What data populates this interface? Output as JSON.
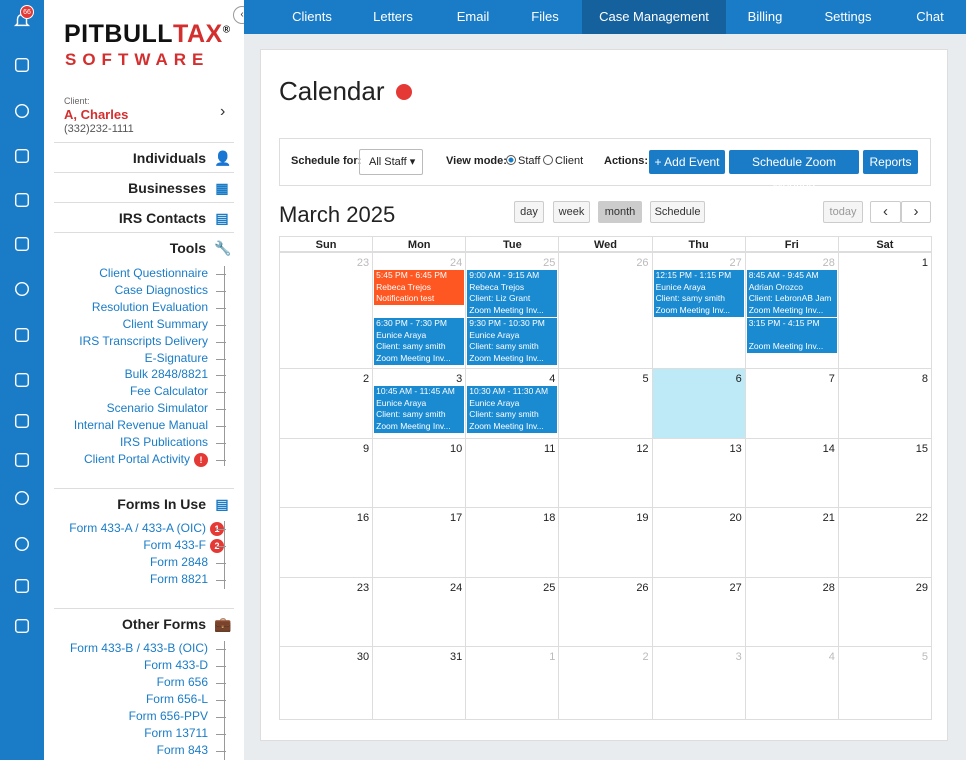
{
  "rail": {
    "bell_badge": "66",
    "icons": [
      "bell-icon",
      "printer-icon",
      "check-circle-icon",
      "add-user-icon",
      "pen-icon",
      "id-card-icon",
      "clock-icon",
      "document-icon",
      "invoice-icon",
      "briefcase-icon",
      "video-icon",
      "lifebuoy-icon",
      "help-icon",
      "robot-icon",
      "presentation-icon"
    ]
  },
  "logo": {
    "line1a": "PITBULL",
    "line1b": "TAX",
    "reg": "®",
    "line2": "SOFTWARE"
  },
  "client": {
    "label": "Client:",
    "name": "A, Charles",
    "phone": "(332)232-1111"
  },
  "sections": {
    "individuals": "Individuals",
    "businesses": "Businesses",
    "irs_contacts": "IRS Contacts",
    "tools": "Tools",
    "forms_in_use": "Forms In Use",
    "other_forms": "Other Forms"
  },
  "tools": [
    "Client Questionnaire",
    "Case Diagnostics",
    "Resolution Evaluation",
    "Client Summary",
    "IRS Transcripts Delivery",
    "E-Signature",
    "Bulk 2848/8821",
    "Fee Calculator",
    "Scenario Simulator",
    "Internal Revenue Manual",
    "IRS Publications",
    "Client Portal Activity"
  ],
  "tools_badge": "!",
  "forms_in_use": [
    {
      "label": "Form 433-A / 433-A (OIC)",
      "badge": "1"
    },
    {
      "label": "Form 433-F",
      "badge": "2"
    },
    {
      "label": "Form 2848",
      "badge": ""
    },
    {
      "label": "Form 8821",
      "badge": ""
    }
  ],
  "other_forms": [
    "Form 433-B / 433-B (OIC)",
    "Form 433-D",
    "Form 656",
    "Form 656-L",
    "Form 656-PPV",
    "Form 13711",
    "Form 843"
  ],
  "nav": {
    "collapse": "‹",
    "items": [
      "Clients",
      "Letters",
      "Email",
      "Files",
      "Case Management",
      "Billing",
      "Settings",
      "Chat"
    ],
    "active": "Case Management"
  },
  "page": {
    "title": "Calendar"
  },
  "toolbar": {
    "schedule_label": "Schedule for:",
    "schedule_value": "All Staff",
    "view_label": "View mode:",
    "view_staff": "Staff",
    "view_client": "Client",
    "actions_label": "Actions:",
    "add_event": "+ Add Event",
    "zoom": "Schedule Zoom Meeting",
    "reports": "Reports"
  },
  "calendar": {
    "month": "March 2025",
    "views": [
      "day",
      "week",
      "month",
      "Schedule"
    ],
    "active_view": "month",
    "today": "today",
    "prev": "‹",
    "next": "›",
    "weekdays": [
      "Sun",
      "Mon",
      "Tue",
      "Wed",
      "Thu",
      "Fri",
      "Sat"
    ],
    "weeks": [
      [
        {
          "d": "23",
          "dim": true
        },
        {
          "d": "24",
          "dim": true
        },
        {
          "d": "25",
          "dim": true
        },
        {
          "d": "26",
          "dim": true
        },
        {
          "d": "27",
          "dim": true
        },
        {
          "d": "28",
          "dim": true
        },
        {
          "d": "1"
        }
      ],
      [
        {
          "d": "2"
        },
        {
          "d": "3"
        },
        {
          "d": "4"
        },
        {
          "d": "5"
        },
        {
          "d": "6",
          "today": true
        },
        {
          "d": "7"
        },
        {
          "d": "8"
        }
      ],
      [
        {
          "d": "9"
        },
        {
          "d": "10"
        },
        {
          "d": "11"
        },
        {
          "d": "12"
        },
        {
          "d": "13"
        },
        {
          "d": "14"
        },
        {
          "d": "15"
        }
      ],
      [
        {
          "d": "16"
        },
        {
          "d": "17"
        },
        {
          "d": "18"
        },
        {
          "d": "19"
        },
        {
          "d": "20"
        },
        {
          "d": "21"
        },
        {
          "d": "22"
        }
      ],
      [
        {
          "d": "23"
        },
        {
          "d": "24"
        },
        {
          "d": "25"
        },
        {
          "d": "26"
        },
        {
          "d": "27"
        },
        {
          "d": "28"
        },
        {
          "d": "29"
        }
      ],
      [
        {
          "d": "30"
        },
        {
          "d": "31"
        },
        {
          "d": "1",
          "dim": true
        },
        {
          "d": "2",
          "dim": true
        },
        {
          "d": "3",
          "dim": true
        },
        {
          "d": "4",
          "dim": true
        },
        {
          "d": "5",
          "dim": true
        }
      ]
    ],
    "events": [
      {
        "week": 0,
        "day": 1,
        "slot": 0,
        "color": "red",
        "lines": [
          "5:45 PM - 6:45 PM",
          "Rebeca Trejos",
          "Notification test"
        ]
      },
      {
        "week": 0,
        "day": 1,
        "slot": 1,
        "lines": [
          "6:30 PM - 7:30 PM",
          "Eunice Araya",
          "Client: samy smith",
          "Zoom Meeting Inv..."
        ]
      },
      {
        "week": 0,
        "day": 2,
        "slot": 0,
        "lines": [
          "9:00 AM - 9:15 AM",
          "Rebeca Trejos",
          "Client: Liz Grant",
          "Zoom Meeting Inv..."
        ]
      },
      {
        "week": 0,
        "day": 2,
        "slot": 1,
        "lines": [
          "9:30 PM - 10:30 PM",
          "Eunice Araya",
          "Client: samy smith",
          "Zoom Meeting Inv..."
        ]
      },
      {
        "week": 0,
        "day": 4,
        "slot": 0,
        "lines": [
          "12:15 PM - 1:15 PM",
          "Eunice Araya",
          "Client: samy smith",
          "Zoom Meeting Inv..."
        ]
      },
      {
        "week": 0,
        "day": 5,
        "slot": 0,
        "lines": [
          "8:45 AM - 9:45 AM",
          "Adrian Orozco",
          "Client: LebronAB Jam",
          "Zoom Meeting Inv..."
        ]
      },
      {
        "week": 0,
        "day": 5,
        "slot": 1,
        "lines": [
          "3:15 PM - 4:15 PM",
          "",
          "Zoom Meeting Inv..."
        ]
      },
      {
        "week": 1,
        "day": 1,
        "slot": 0,
        "lines": [
          "10:45 AM - 11:45 AM",
          "Eunice Araya",
          "Client: samy smith",
          "Zoom Meeting Inv..."
        ]
      },
      {
        "week": 1,
        "day": 2,
        "slot": 0,
        "lines": [
          "10:30 AM - 11:30 AM",
          "Eunice Araya",
          "Client: samy smith",
          "Zoom Meeting Inv..."
        ]
      }
    ]
  }
}
